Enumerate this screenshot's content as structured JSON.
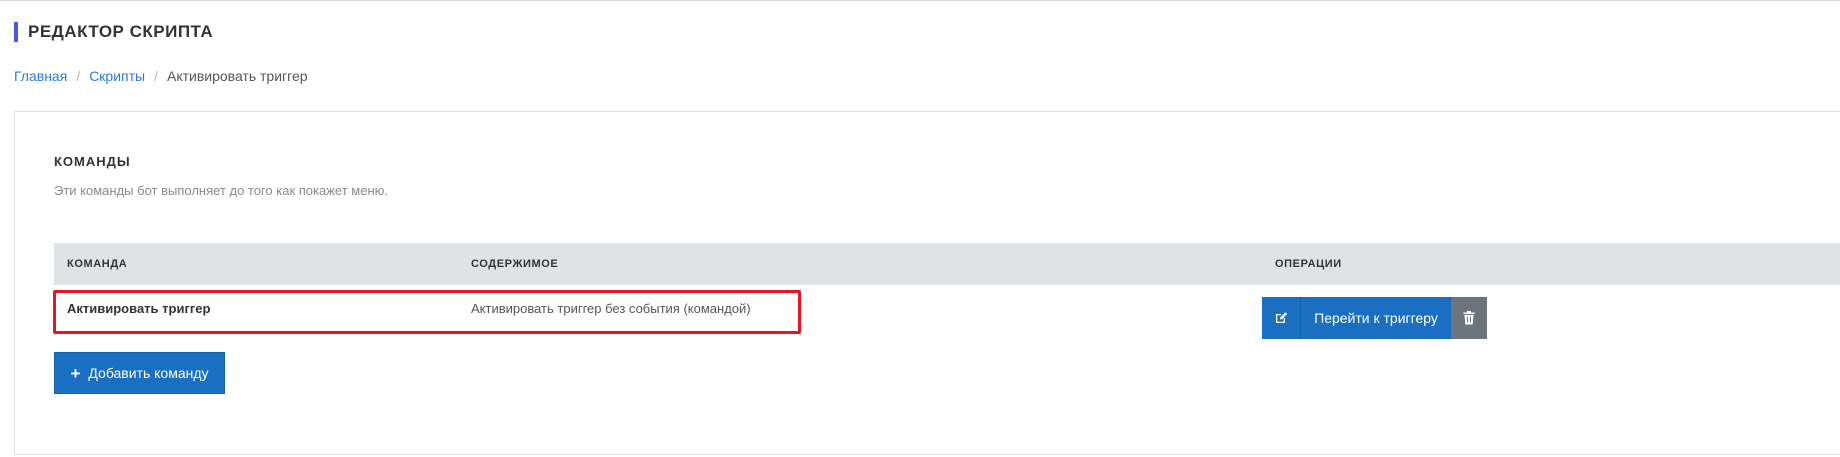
{
  "header": {
    "title": "РЕДАКТОР СКРИПТА",
    "accent_color": "#4a5bd6"
  },
  "breadcrumb": {
    "items": [
      {
        "label": "Главная",
        "link": true
      },
      {
        "label": "Скрипты",
        "link": true
      },
      {
        "label": "Активировать триггер",
        "link": false
      }
    ],
    "separator": "/"
  },
  "commands": {
    "title": "КОМАНДЫ",
    "description": "Эти команды бот выполняет до того как покажет меню.",
    "columns": [
      "КОМАНДА",
      "СОДЕРЖИМОЕ",
      "ОПЕРАЦИИ"
    ],
    "rows": [
      {
        "command": "Активировать триггер",
        "content": "Активировать триггер без события (командой)",
        "operations": {
          "edit_icon": "edit-icon",
          "goto_label": "Перейти к триггеру",
          "delete_icon": "trash-icon"
        }
      }
    ],
    "add_button": {
      "icon": "plus-icon",
      "label": "Добавить команду"
    }
  },
  "colors": {
    "primary_button": "#1b6fc2",
    "secondary_button": "#6c757d",
    "table_header_bg": "#e0e3e6",
    "highlight": "#e8141e",
    "link": "#2b7ad8"
  }
}
